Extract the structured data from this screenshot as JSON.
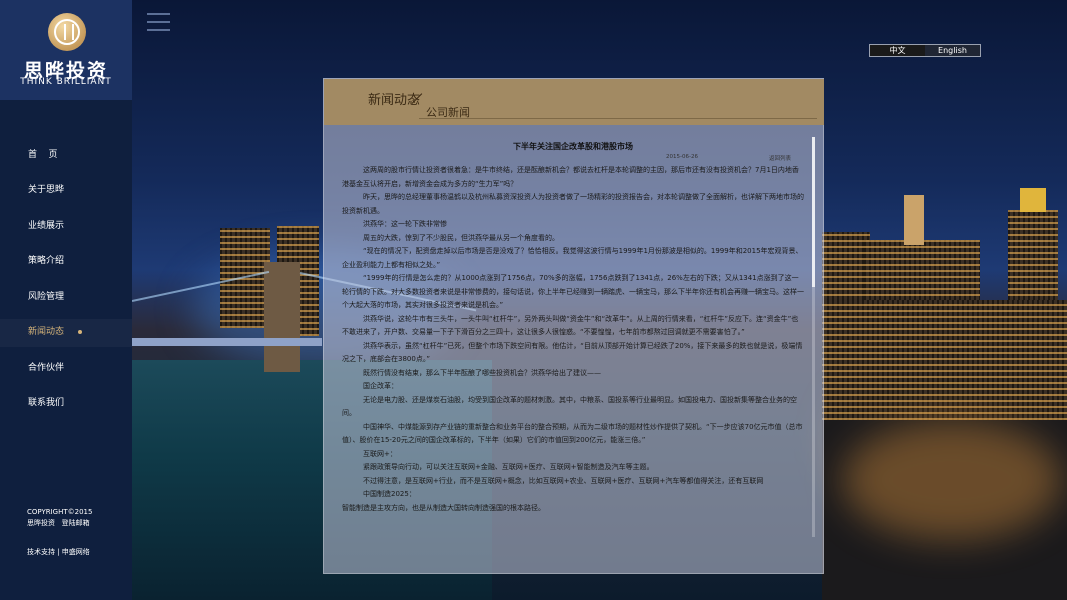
{
  "brand": {
    "name_cn": "思晔投资",
    "name_en": "THINK BRILLIANT"
  },
  "nav": {
    "items": [
      {
        "label": "首    页"
      },
      {
        "label": "关于思晔"
      },
      {
        "label": "业绩展示"
      },
      {
        "label": "策略介绍"
      },
      {
        "label": "风险管理"
      },
      {
        "label": "新闻动态"
      },
      {
        "label": "合作伙伴"
      },
      {
        "label": "联系我们"
      }
    ],
    "active_index": 5
  },
  "footer": {
    "copyright": "COPYRIGHT©2015",
    "company_line": "思晔投资   登陆邮箱",
    "tech": "技术支持 | 申盛网络"
  },
  "language": {
    "zh": "中文",
    "en": "English",
    "selected": "中文"
  },
  "panel": {
    "title": "新闻动态",
    "subtitle": "公司新闻"
  },
  "article": {
    "title": "下半年关注国企改革股和港股市场",
    "date": "2015-06-26",
    "back": "返回列表",
    "paragraphs": [
      "这两周的股市行情让投资者很着急：是牛市终结，还是酝酿新机会？都说去杠杆是本轮调整的主因，那后市还有没有投资机会？7月1日内地香港基金互认将开启，新增资金会成为多方的“生力军”吗？",
      "昨天，思晔的总经理董事杨温鹤以及杭州私募资深投资人为投资者做了一场精彩的投资报告会，对本轮调整做了全面解析，也详解下两地市场的投资新机遇。",
      "洪燕华：这一轮下跌非常惨",
      "周五的大跌，惊到了不少股民，但洪燕华最从另一个角度看的。",
      "“现在的情况下，配资盘走掉以后市场是否是没戏了？恰恰相反。我觉得这波行情与1999年1月份那波是相似的。1999年和2015年宏观背景、企业盈利能力上都有相似之处。”",
      "“1999年的行情是怎么走的？从1000点涨到了1756点，70%多的涨幅，1756点跌到了1341点，26%左右的下跌；又从1341点涨到了这一轮行情的下跌。对大多数投资者来说是非常惨费的，接句话说，你上半年已经赚到一辆踏虎、一辆宝马，那么下半年你还有机会再赚一辆宝马。这样一个大起大落的市场，其实对很多投资者来说是机会。”",
      "洪燕华说，这轮牛市有三头牛，一头牛叫“杠杆牛”，另外两头叫做“资金牛”和“改革牛”。从上周的行情来看，“杠杆牛”反应下。连“资金牛”也不敢进来了，开户数、交易量一下子下滑百分之三四十，这让很多人很惶惑。“不要惶惶，七年前市都熬过回调就更不需要害怕了。”",
      "洪燕华表示，虽然“杠杆牛”已死，但整个市场下跌空间有限。他估计，“目前从顶部开始计算已经跌了20%，接下来最多的跌也就是说，极端情况之下，底部会在3800点。”",
      "既然行情没有结束，那么下半年酝酿了哪些投资机会？洪燕华给出了建议——",
      "国企改革：",
      "无论是电力股、还是煤炭石油股，均受到国企改革的题材刺激。其中，中粮系、国投系等行业最明显。如国投电力、国投新集等整合业务的空间。",
      "中国神华、中煤能源到存产业链的重新整合和业务平台的整合预期，从而为二级市场的题材性炒作提供了契机。“下一步应该70亿元市值（总市值）、股价在15-20元之间的国企改革标的，下半年（如果）它们的市值回到200亿元，能涨三倍。”",
      "互联网+：",
      "紧跟政策导向行动，可以关注互联网+金融、互联网+医疗、互联网+智能制造及汽车等主题。",
      "不过得注意，是互联网+行业，而不是互联网+概念，比如互联网+农业、互联网+医疗、互联网+汽车等都值得关注，还有互联网",
      "中国制造2025：",
      "智能制造是主攻方向，也是从制造大国转向制造强国的根本路径。"
    ]
  }
}
